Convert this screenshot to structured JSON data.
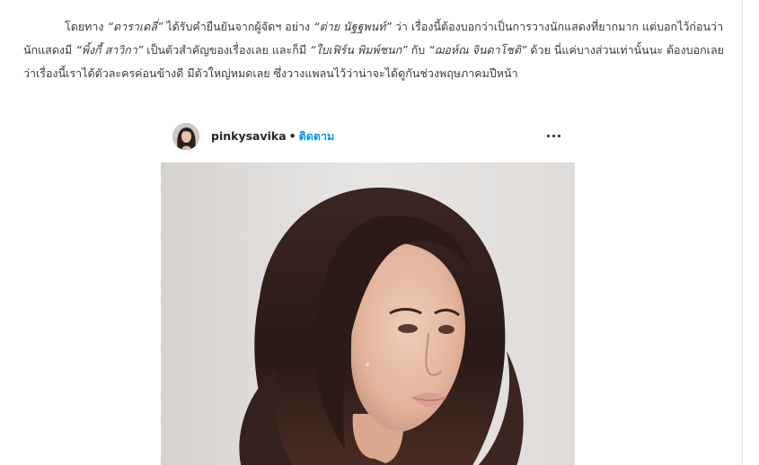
{
  "article": {
    "seg1": "โดยทาง ",
    "ent1": "“ดาราเดลี่”",
    "seg2": " ได้รับคำยืนยันจากผู้จัดฯ อย่าง ",
    "ent2": "“ต่าย นัฐฐพนท์”",
    "seg3": " ว่า เรื่องนี้ต้องบอกว่าเป็นการวางนักแสดงที่ยากมาก แต่บอกไว้ก่อนว่านักแสดงมี ",
    "ent3": "“พิ้งกี้ สาวิกา”",
    "seg4": " เป็นตัวสำคัญของเรื่องเลย และก็มี ",
    "ent4": "“ใบเฟิร์น พิมพ์ชนก”",
    "seg5": " กับ ",
    "ent5": "“ฌอห์ณ จินดาโชติ”",
    "seg6": " ด้วย นี่แค่บางส่วนเท่านั้นนะ ต้องบอกเลยว่าเรื่องนี้เราได้ตัวละครค่อนข้างดี มีตัวใหญ่หมดเลย ซึ่งวางแพลนไว้ว่าน่าจะได้ดูกันช่วงพฤษภาคมปีหน้า"
  },
  "instagram_post": {
    "username": "pinkysavika",
    "separator": "•",
    "follow_label": "ติดตาม",
    "more_icon": "more-horizontal-icon",
    "accent_color": "#0095f6"
  }
}
